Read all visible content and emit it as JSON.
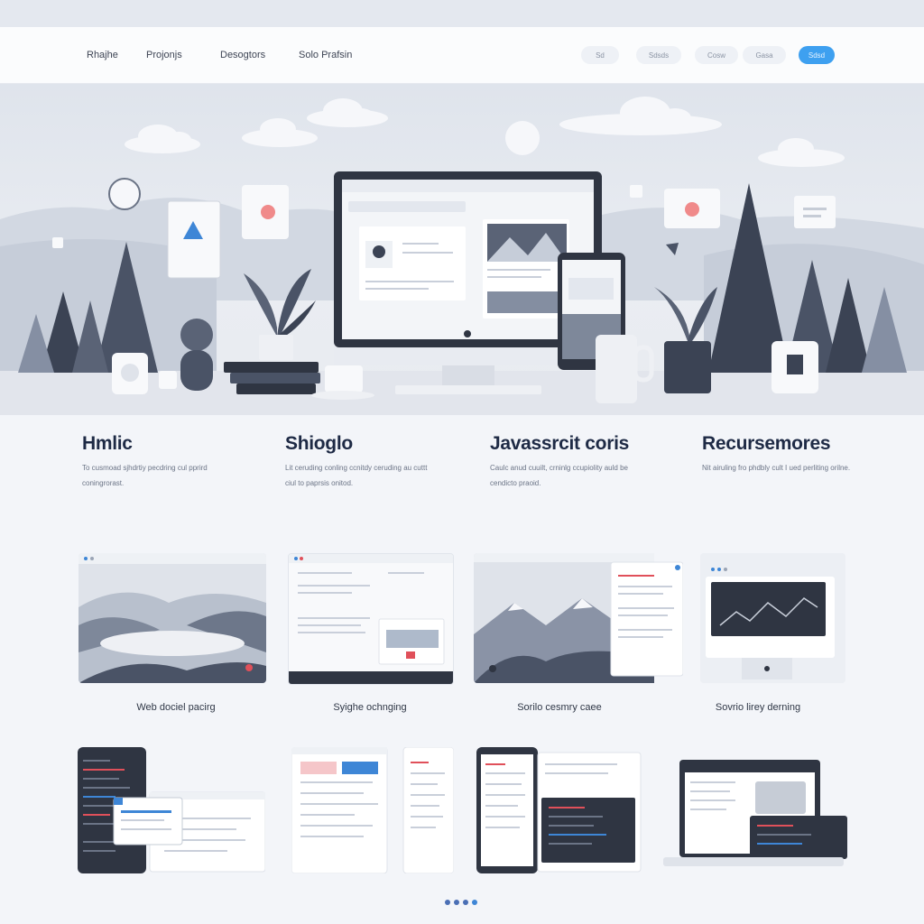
{
  "nav": {
    "links": [
      "Rhajhe",
      "Projonjs",
      "Desogtors",
      "Solo Prafsin"
    ],
    "pills": [
      "Sd",
      "Sdsds",
      "Cosw",
      "Gasa"
    ],
    "cta": "Sdsd"
  },
  "features": [
    {
      "title": "Hmlic",
      "text": "To cusmoad sjhdrtiy pecdring cul pprird coningrorast."
    },
    {
      "title": "Shioglo",
      "text": "Lit ceruding conling ccnitdy ceruding au cuttt ciul to paprsis onitod."
    },
    {
      "title": "Javassrcit coris",
      "text": "Caulc anud cuuilt, crninlg ccupiolity auld be cendicto praoid."
    },
    {
      "title": "Recursemores",
      "text": "Nit airuling fro phdbly cult I ued perliting orilne."
    }
  ],
  "showcase": {
    "captions": [
      "Web dociel pacirg",
      "Syighe ochnging",
      "Sorilo cesmry caee",
      "Sovrio lirey derning"
    ]
  },
  "pagination": {
    "dots": 4,
    "active": 0
  },
  "colors": {
    "accent": "#3ea0f0",
    "dark": "#2f3542",
    "bg": "#f3f5f9"
  }
}
